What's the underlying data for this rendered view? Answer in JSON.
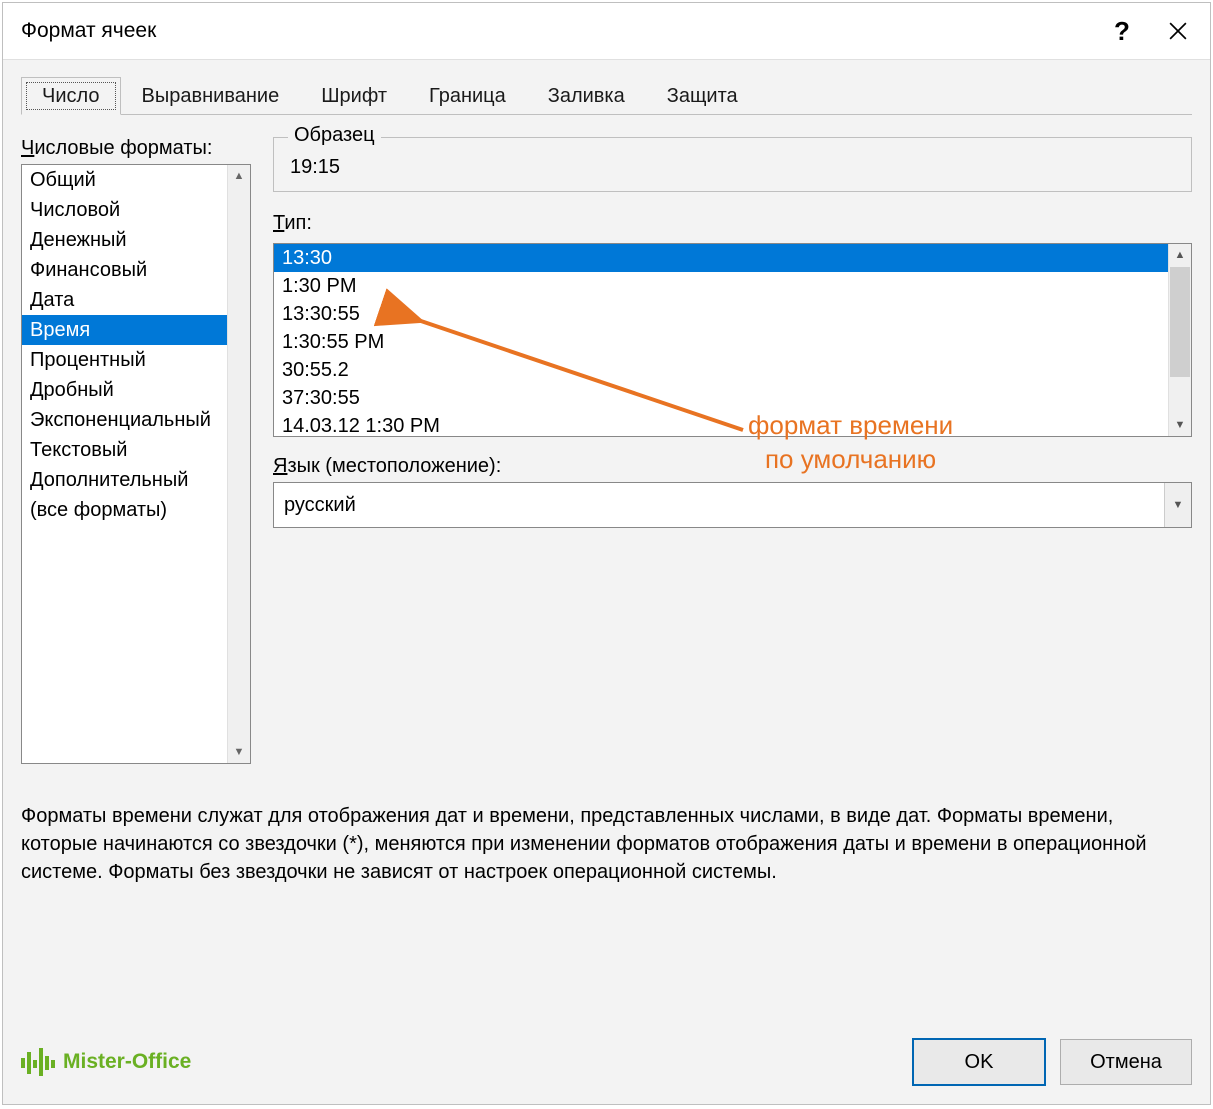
{
  "titlebar": {
    "title": "Формат ячеек"
  },
  "tabs": [
    {
      "label": "Число",
      "active": true
    },
    {
      "label": "Выравнивание"
    },
    {
      "label": "Шрифт"
    },
    {
      "label": "Граница"
    },
    {
      "label": "Заливка"
    },
    {
      "label": "Защита"
    }
  ],
  "category": {
    "label": "Числовые форматы:",
    "items": [
      "Общий",
      "Числовой",
      "Денежный",
      "Финансовый",
      "Дата",
      "Время",
      "Процентный",
      "Дробный",
      "Экспоненциальный",
      "Текстовый",
      "Дополнительный",
      "(все форматы)"
    ],
    "selected_index": 5
  },
  "sample": {
    "legend": "Образец",
    "value": "19:15"
  },
  "type": {
    "label": "Тип:",
    "items": [
      "13:30",
      "1:30 PM",
      "13:30:55",
      "1:30:55 PM",
      "30:55.2",
      "37:30:55",
      "14.03.12 1:30 PM"
    ],
    "selected_index": 0
  },
  "locale": {
    "label": "Язык (местоположение):",
    "value": "русский"
  },
  "description": "Форматы времени служат для отображения дат и времени, представленных числами, в виде дат. Форматы времени, которые начинаются со звездочки (*), меняются при изменении форматов отображения даты и времени в операционной системе. Форматы без звездочки не зависят от настроек операционной системы.",
  "buttons": {
    "ok": "OK",
    "cancel": "Отмена"
  },
  "brand": "Mister-Office",
  "annotation": {
    "line1": "формат времени",
    "line2": "по умолчанию"
  }
}
